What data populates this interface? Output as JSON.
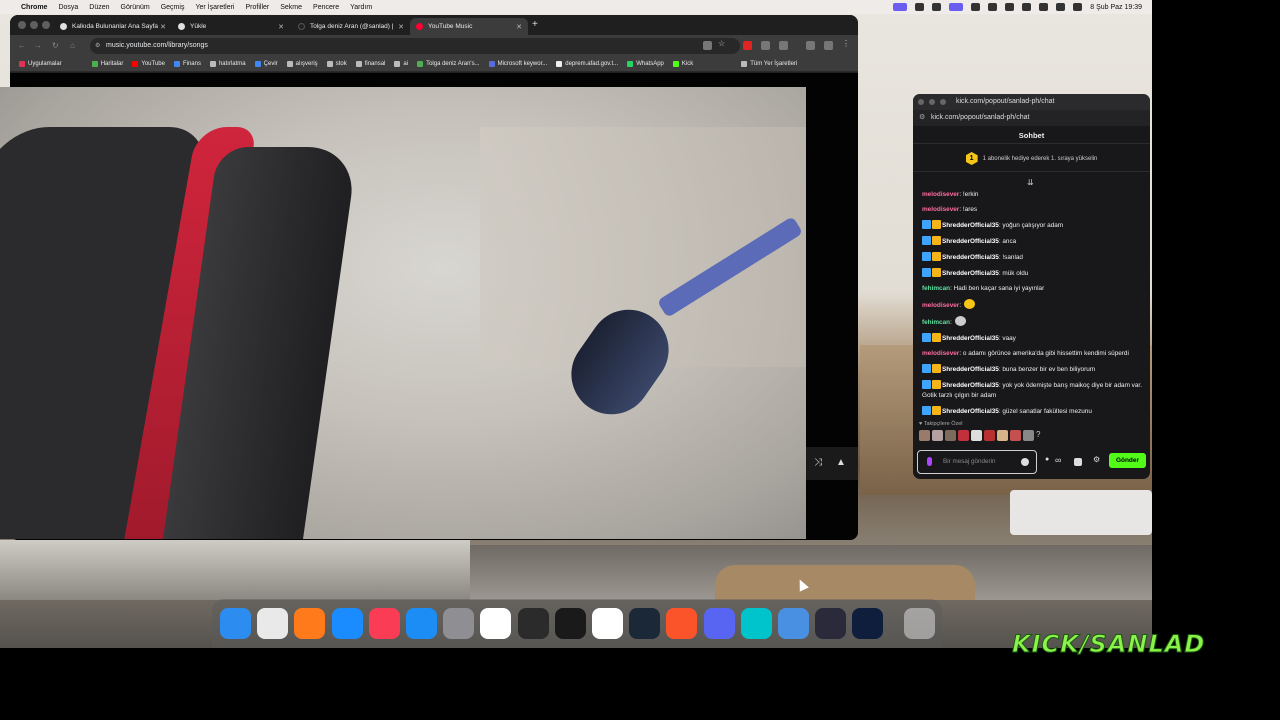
{
  "menubar": {
    "app_name": "Chrome",
    "items": [
      "Dosya",
      "Düzen",
      "Görünüm",
      "Geçmiş",
      "Yer İşaretleri",
      "Profiller",
      "Sekme",
      "Pencere",
      "Yardım"
    ],
    "clock": "8 Şub Paz  19:39"
  },
  "browser": {
    "tabs": [
      {
        "label": "Kalkıda Bulunanlar Ana Sayfa",
        "favicon_color": "#e0e0e0"
      },
      {
        "label": "Yükle",
        "favicon_color": "#e0e0e0"
      },
      {
        "label": "Tolga deniz Aran (@sanlad) |",
        "favicon_color": "#222222"
      },
      {
        "label": "YouTube Music",
        "favicon_color": "#ff0033"
      }
    ],
    "url": "music.youtube.com/library/songs",
    "bookmarks": [
      "Uygulamalar",
      "Haritalar",
      "YouTube",
      "Finans",
      "hatırlatma",
      "Çevir",
      "alışveriş",
      "stok",
      "finansal",
      "ai",
      "Tolga deniz Aran's...",
      "Microsoft keywor...",
      "deprem.afad.gov.t...",
      "WhatsApp",
      "Kick",
      "Tüm Yer İşaretleri"
    ]
  },
  "kick": {
    "title": "kick.com/popout/sanlad-ph/chat",
    "url": "kick.com/popout/sanlad-ph/chat",
    "header": "Sohbet",
    "gift_rank": "1",
    "gift_banner": "1 abonelik hediye ederek 1. sıraya yükselin",
    "messages": [
      {
        "user": "melodisever",
        "color": "#ff6b9d",
        "text": ": !erkin",
        "badges": false
      },
      {
        "user": "melodisever",
        "color": "#ff6b9d",
        "text": ": !ares",
        "badges": false
      },
      {
        "user": "ShredderOfficial35",
        "color": "#ffffff",
        "text": ": yoğun çalışıyor adam",
        "badges": true
      },
      {
        "user": "ShredderOfficial35",
        "color": "#ffffff",
        "text": ": anca",
        "badges": true
      },
      {
        "user": "ShredderOfficial35",
        "color": "#ffffff",
        "text": ": !sanlad",
        "badges": true
      },
      {
        "user": "ShredderOfficial35",
        "color": "#ffffff",
        "text": ": mük oldu",
        "badges": true
      },
      {
        "user": "fehimcan",
        "color": "#5ee0a0",
        "text": ": Hadi ben kaçar sana iyi yayınlar",
        "badges": false
      },
      {
        "user": "melodisever",
        "color": "#ff6b9d",
        "text": ":",
        "badges": false,
        "emote": "#f5c518"
      },
      {
        "user": "fehimcan",
        "color": "#5ee0a0",
        "text": ":",
        "badges": false,
        "emote": "#cccccc"
      },
      {
        "user": "ShredderOfficial35",
        "color": "#ffffff",
        "text": ": vaay",
        "badges": true
      },
      {
        "user": "melodisever",
        "color": "#ff6b9d",
        "text": ": o adamı görünce amerika'da gibi hissettim kendimi süperdi",
        "badges": false
      },
      {
        "user": "ShredderOfficial35",
        "color": "#ffffff",
        "text": ": buna benzer bir ev ben biliyorum",
        "badges": true
      },
      {
        "user": "ShredderOfficial35",
        "color": "#ffffff",
        "text": ": yok yok ödemişte barış maikoç diye bir adam var. Gotik tarzlı çılgın bir adam",
        "badges": true
      },
      {
        "user": "ShredderOfficial35",
        "color": "#ffffff",
        "text": ": güzel sanatlar fakültesi mezunu",
        "badges": true
      }
    ],
    "follower_label": "♥ Takipçilere Özel",
    "input_placeholder": "Bir mesaj gönderin",
    "infinity": "∞",
    "send_label": "Gönder"
  },
  "video_controls": {
    "shuffle": "⤨",
    "expand": "▲"
  },
  "dock_apps": [
    "Finder",
    "Launchpad",
    "Firefox",
    "Safari",
    "Music",
    "App Store",
    "System Settings",
    "Chrome",
    "DaVinci Resolve",
    "Perplexity",
    "ChatGPT",
    "Steam",
    "Brave",
    "Discord",
    "Canva",
    "Simulator",
    "OBS",
    "Lightroom",
    "Trash"
  ],
  "overlay_text": "KICK/SANLAD"
}
